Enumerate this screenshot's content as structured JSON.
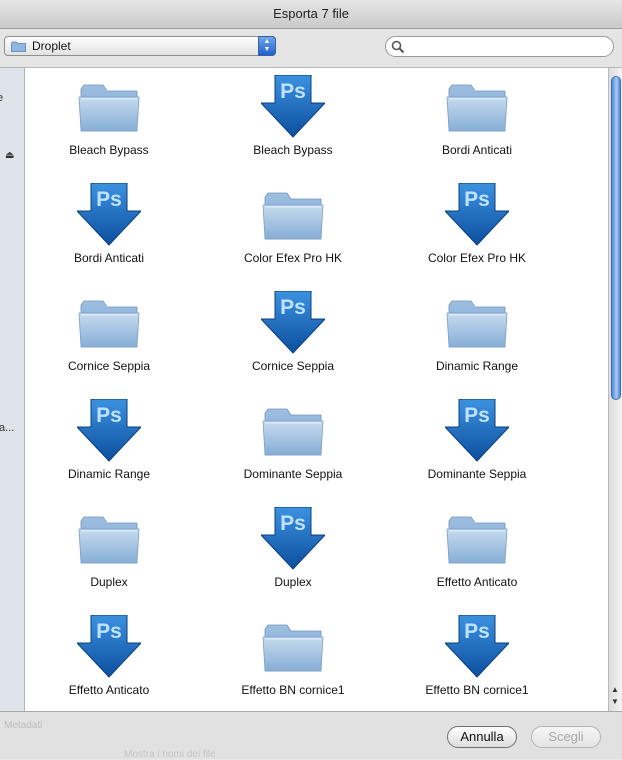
{
  "window": {
    "title": "Esporta 7 file"
  },
  "toolbar": {
    "location": "Droplet",
    "search_value": "",
    "search_placeholder": ""
  },
  "sidebar": {
    "fragment_1": "e",
    "eject_glyph": "⏏",
    "fragment_2": "a..."
  },
  "items": [
    {
      "name": "Bleach Bypass",
      "kind": "folder-icon"
    },
    {
      "name": "Bleach Bypass",
      "kind": "droplet-icon"
    },
    {
      "name": "Bordi Anticati",
      "kind": "folder-icon"
    },
    {
      "name": "Bordi Anticati",
      "kind": "droplet-icon"
    },
    {
      "name": "Color Efex Pro HK",
      "kind": "folder-icon"
    },
    {
      "name": "Color Efex Pro HK",
      "kind": "droplet-icon"
    },
    {
      "name": "Cornice Seppia",
      "kind": "folder-icon"
    },
    {
      "name": "Cornice Seppia",
      "kind": "droplet-icon"
    },
    {
      "name": "Dinamic Range",
      "kind": "folder-icon"
    },
    {
      "name": "Dinamic Range",
      "kind": "droplet-icon"
    },
    {
      "name": "Dominante Seppia",
      "kind": "folder-icon"
    },
    {
      "name": "Dominante Seppia",
      "kind": "droplet-icon"
    },
    {
      "name": "Duplex",
      "kind": "folder-icon"
    },
    {
      "name": "Duplex",
      "kind": "droplet-icon"
    },
    {
      "name": "Effetto Anticato",
      "kind": "folder-icon"
    },
    {
      "name": "Effetto Anticato",
      "kind": "droplet-icon"
    },
    {
      "name": "Effetto BN cornice1",
      "kind": "folder-icon"
    },
    {
      "name": "Effetto BN cornice1",
      "kind": "droplet-icon"
    }
  ],
  "ps_label": "Ps",
  "footer": {
    "ghost_label": "Metadati",
    "ghost_option": "Mostra i nomi dei file",
    "cancel_label": "Annulla",
    "choose_label": "Scegli"
  },
  "colors": {
    "droplet_blue": "#1a6fc6",
    "folder_blue": "#a9c6e4",
    "scroll_blue": "#4c86d8"
  }
}
